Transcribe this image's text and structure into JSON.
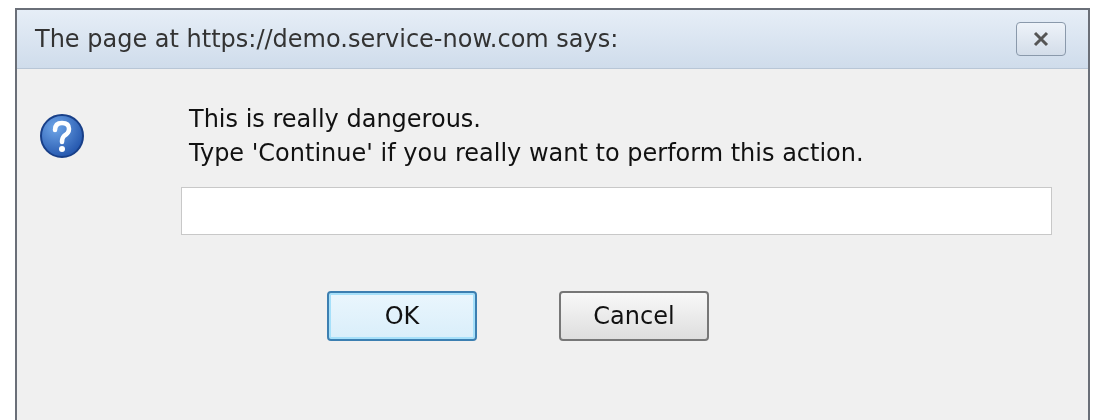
{
  "window": {
    "title": "The page at https://demo.service-now.com says:"
  },
  "message": [
    "This is really dangerous.",
    "Type 'Continue' if you really want to perform this action."
  ],
  "buttons": [
    {
      "label": "OK",
      "default": true
    },
    {
      "label": "Cancel",
      "default": false
    }
  ]
}
